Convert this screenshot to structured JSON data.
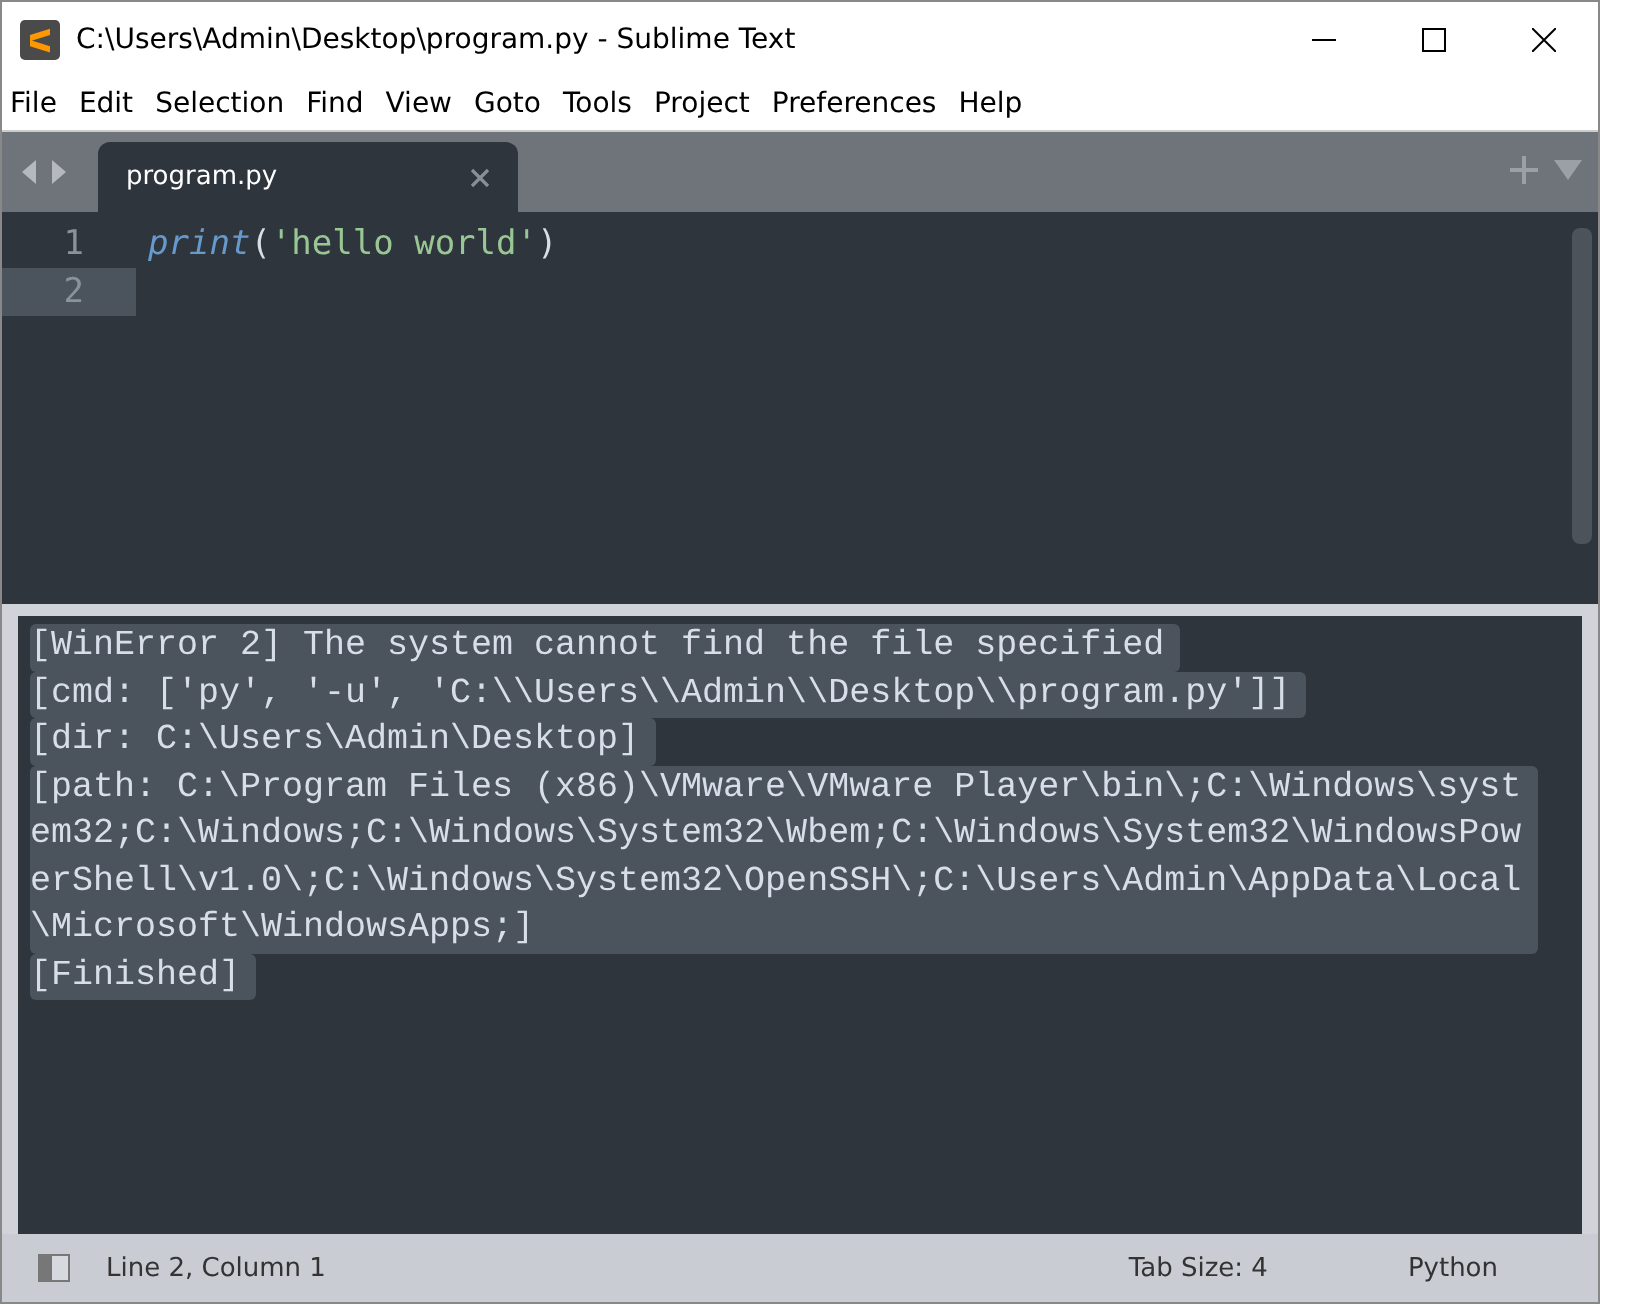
{
  "window": {
    "title": "C:\\Users\\Admin\\Desktop\\program.py - Sublime Text"
  },
  "menu": [
    "File",
    "Edit",
    "Selection",
    "Find",
    "View",
    "Goto",
    "Tools",
    "Project",
    "Preferences",
    "Help"
  ],
  "tabs": [
    {
      "label": "program.py",
      "selected": true
    }
  ],
  "editor": {
    "lines": [
      {
        "number": "1",
        "func": "print",
        "open": "(",
        "string": "'hello world'",
        "close": ")",
        "current": false
      },
      {
        "number": "2",
        "current": true
      }
    ]
  },
  "output": {
    "selected": true,
    "lines": [
      "[WinError 2] The system cannot find the file specified",
      "[cmd: ['py', '-u', 'C:\\\\Users\\\\Admin\\\\Desktop\\\\program.py']]",
      "[dir: C:\\Users\\Admin\\Desktop]",
      "[path: C:\\Program Files (x86)\\VMware\\VMware Player\\bin\\;C:\\Windows\\system32;C:\\Windows;C:\\Windows\\System32\\Wbem;C:\\Windows\\System32\\WindowsPowerShell\\v1.0\\;C:\\Windows\\System32\\OpenSSH\\;C:\\Users\\Admin\\AppData\\Local\\Microsoft\\WindowsApps;]",
      "[Finished]"
    ]
  },
  "status_bar": {
    "position": "Line 2, Column 1",
    "tab_size": "Tab Size: 4",
    "syntax": "Python"
  }
}
